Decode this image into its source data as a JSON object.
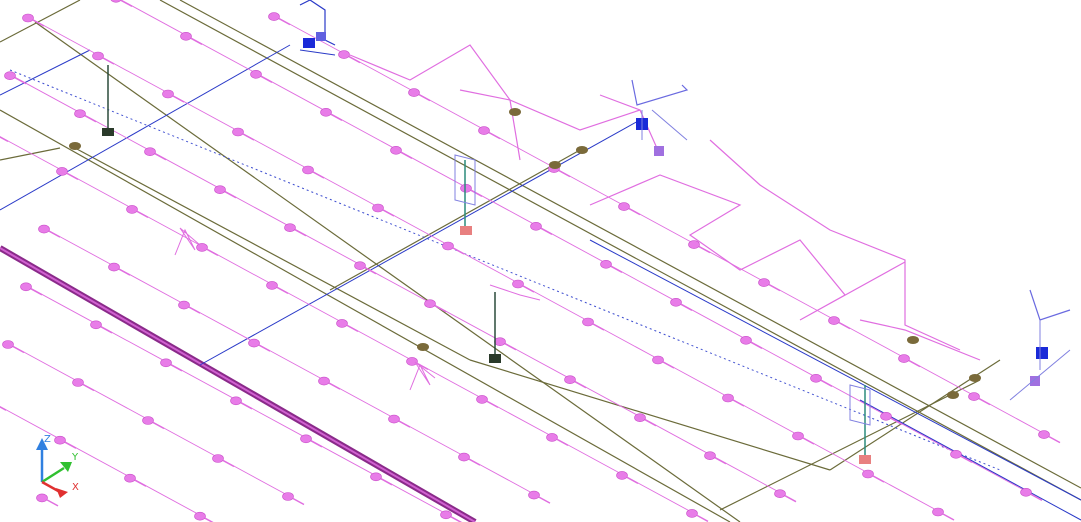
{
  "viewport": {
    "background": "#ffffff",
    "colors": {
      "sprinkler": "#e87ce8",
      "sprinkler_edge": "#c94fc9",
      "branch_pipe": "#e06ee0",
      "main_pipe": "#8a2a8a",
      "olive_pipe": "#6b6b3a",
      "blue_pipe": "#2a3ac8",
      "fitting_brown": "#7a6a3a",
      "valve_blue": "#1a2ad8",
      "riser_teal": "#2a8a7a",
      "red_fitting": "#e88080"
    }
  },
  "ucs_icon": {
    "icon": "ucs-axis-icon",
    "x_label": "X",
    "y_label": "Y",
    "z_label": "Z",
    "x_color": "#e03030",
    "y_color": "#30c030",
    "z_color": "#3080e0"
  }
}
